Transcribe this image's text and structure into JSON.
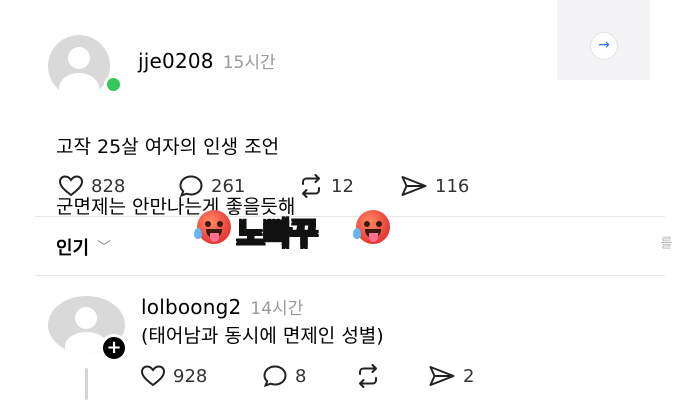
{
  "post": {
    "username": "jje0208",
    "time": "15시간",
    "lines": [
      "고작 25살 여자의 인생 조언",
      "군면제는 안만나는게 좋을듯해"
    ],
    "likes": "828",
    "comments": "261",
    "reposts": "12",
    "shares": "116"
  },
  "side_panel": {
    "arrow": "→",
    "edge_text": "를"
  },
  "sort": {
    "label": "인기",
    "chevron": "﹀"
  },
  "overlay": {
    "text": "노빠꾸"
  },
  "reply": {
    "username": "lolboong2",
    "time": "14시간",
    "text": "(태어남과 동시에 면제인 성별)",
    "likes": "928",
    "comments": "8",
    "reposts": "",
    "shares": "2"
  },
  "colors": {
    "online": "#34c759",
    "time_gray": "#999999",
    "accent": "#2f6ee8"
  },
  "icons": [
    "heart-icon",
    "comment-icon",
    "repost-icon",
    "send-icon",
    "chevron-down-icon",
    "arrow-right-icon",
    "plus-icon"
  ]
}
